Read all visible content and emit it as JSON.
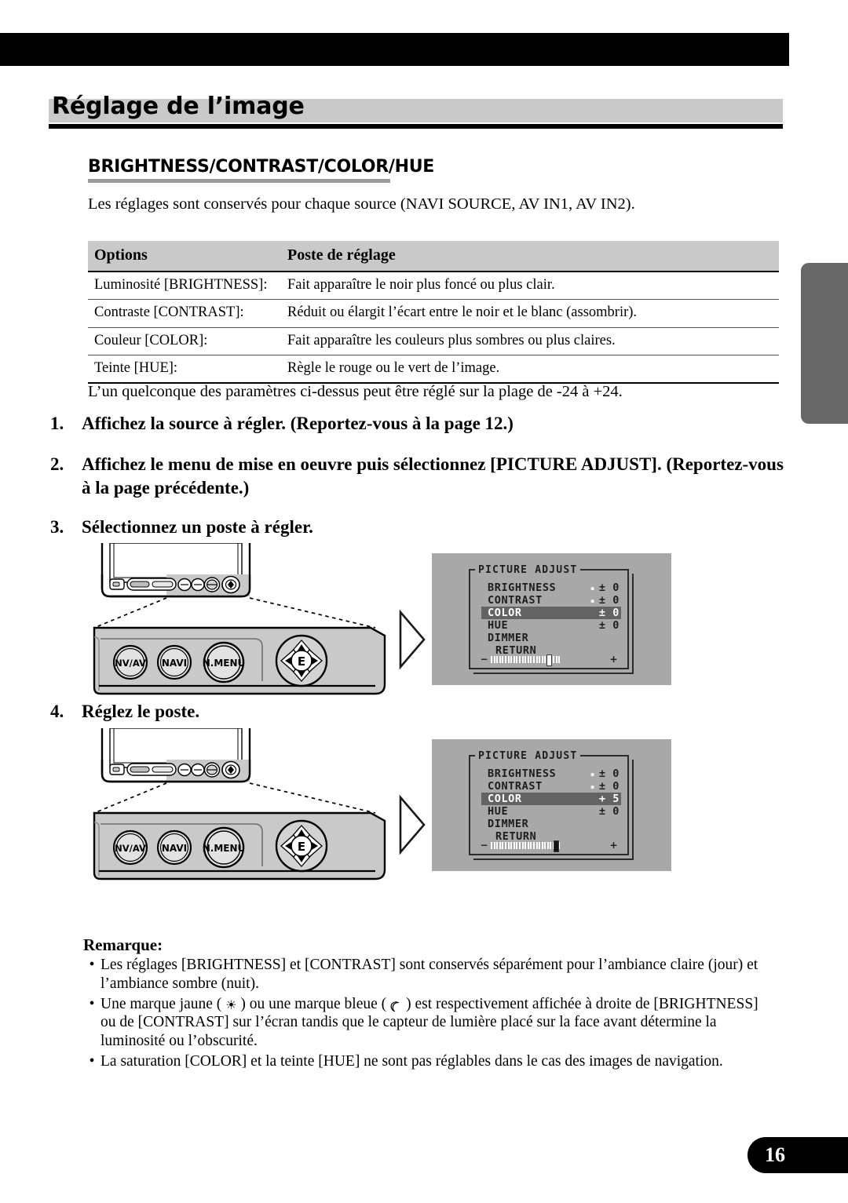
{
  "chapter": {
    "title": "Réglage de l’image"
  },
  "section": {
    "title": "BRIGHTNESS/CONTRAST/COLOR/HUE"
  },
  "intro": "Les réglages sont conservés pour chaque source (NAVI SOURCE, AV IN1, AV IN2).",
  "table": {
    "headers": [
      "Options",
      "Poste de réglage"
    ],
    "rows": [
      [
        "Luminosité [BRIGHTNESS]:",
        "Fait apparaître le noir plus foncé ou plus clair."
      ],
      [
        "Contraste [CONTRAST]:",
        "Réduit ou élargit l’écart entre le noir et le blanc (assombrir)."
      ],
      [
        "Couleur [COLOR]:",
        "Fait apparaître les couleurs plus sombres ou plus claires."
      ],
      [
        "Teinte [HUE]:",
        "Règle le rouge ou le vert de l’image."
      ]
    ]
  },
  "range_note": "L’un quelconque des paramètres ci-dessus peut être réglé sur la plage de -24 à +24.",
  "steps": [
    {
      "num": "1.",
      "text": "Affichez la source à régler. (Reportez-vous à la page 12.)"
    },
    {
      "num": "2.",
      "text": "Affichez le menu de mise en oeuvre puis sélectionnez [PICTURE ADJUST]. (Reportez-vous à la page précédente.)"
    },
    {
      "num": "3.",
      "text": "Sélectionnez un poste à régler."
    },
    {
      "num": "4.",
      "text": "Réglez le poste."
    }
  ],
  "device": {
    "buttons": [
      "NV/AV",
      "NAVI",
      "N.MENU"
    ],
    "pad_center": "E"
  },
  "osd": [
    {
      "title": "PICTURE ADJUST",
      "rows": [
        {
          "label": "BRIGHTNESS",
          "icon": "sun-icon",
          "value": "± 0",
          "selected": false
        },
        {
          "label": "CONTRAST",
          "icon": "sun-icon",
          "value": "± 0",
          "selected": false
        },
        {
          "label": "COLOR",
          "icon": "",
          "value": "± 0",
          "selected": true
        },
        {
          "label": "HUE",
          "icon": "",
          "value": "± 0",
          "selected": false
        },
        {
          "label": "DIMMER",
          "icon": "",
          "value": "",
          "selected": false
        },
        {
          "label": "RETURN",
          "icon": "",
          "value": "",
          "selected": false,
          "indent": true
        }
      ],
      "slider": {
        "minus": "−",
        "plus": "+",
        "knob_percent": 50,
        "knob_filled": false
      }
    },
    {
      "title": "PICTURE ADJUST",
      "rows": [
        {
          "label": "BRIGHTNESS",
          "icon": "sun-icon",
          "value": "± 0",
          "selected": false
        },
        {
          "label": "CONTRAST",
          "icon": "sun-icon",
          "value": "± 0",
          "selected": false
        },
        {
          "label": "COLOR",
          "icon": "",
          "value": "+ 5",
          "selected": true
        },
        {
          "label": "HUE",
          "icon": "",
          "value": "± 0",
          "selected": false
        },
        {
          "label": "DIMMER",
          "icon": "",
          "value": "",
          "selected": false
        },
        {
          "label": "RETURN",
          "icon": "",
          "value": "",
          "selected": false,
          "indent": true
        }
      ],
      "slider": {
        "minus": "−",
        "plus": "+",
        "knob_percent": 56,
        "knob_filled": true
      }
    }
  ],
  "notes": {
    "heading": "Remarque:",
    "items": [
      {
        "pre": "Les réglages [BRIGHTNESS] et [CONTRAST] sont conservés séparément pour l’ambiance claire (jour) et l’ambiance sombre (nuit).",
        "post": ""
      },
      {
        "pre": "Une marque jaune ( ",
        "mid1": " ) ou une marque bleue ( ",
        "mid2": " ) est respectivement affichée à droite de [BRIGHTNESS] ou de [CONTRAST] sur l’écran tandis que le capteur de lumière placé sur la face avant détermine la luminosité ou l’obscurité."
      },
      {
        "pre": "La saturation [COLOR] et la teinte [HUE] ne sont pas réglables dans le cas des images de navigation.",
        "post": ""
      }
    ],
    "bullet": "•"
  },
  "page_number": "16"
}
